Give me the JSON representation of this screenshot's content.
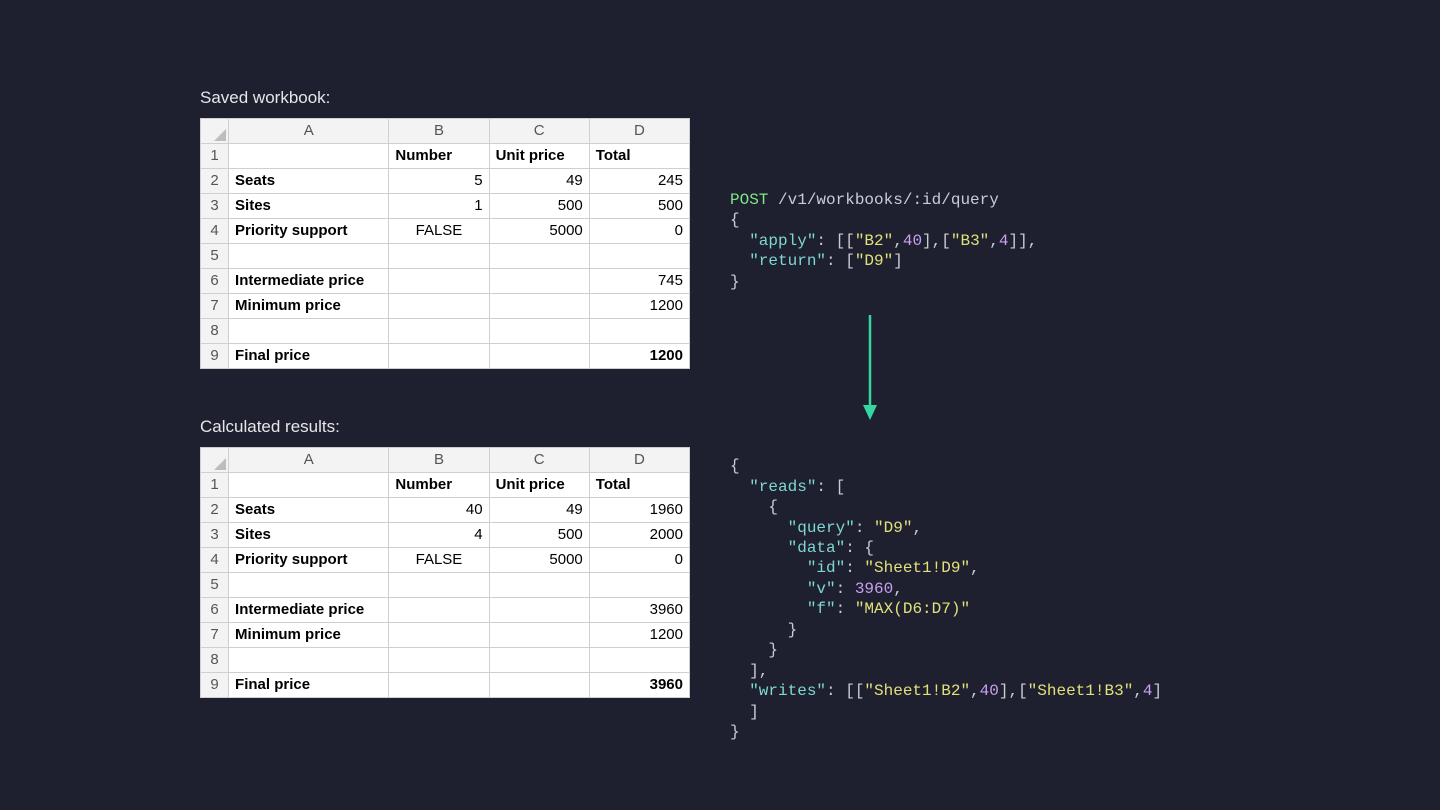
{
  "labels": {
    "saved": "Saved workbook:",
    "calculated": "Calculated results:"
  },
  "columns": [
    "A",
    "B",
    "C",
    "D"
  ],
  "header_row": {
    "B": "Number",
    "C": "Unit price",
    "D": "Total"
  },
  "row_labels": {
    "2": "Seats",
    "3": "Sites",
    "4": "Priority support",
    "6": "Intermediate price",
    "7": "Minimum price",
    "9": "Final price"
  },
  "saved": {
    "B2": "5",
    "C2": "49",
    "D2": "245",
    "B3": "1",
    "C3": "500",
    "D3": "500",
    "B4": "FALSE",
    "C4": "5000",
    "D4": "0",
    "D6": "745",
    "D7": "1200",
    "D9": "1200"
  },
  "calc": {
    "B2": "40",
    "C2": "49",
    "D2": "1960",
    "B3": "4",
    "C3": "500",
    "D3": "2000",
    "B4": "FALSE",
    "C4": "5000",
    "D4": "0",
    "D6": "3960",
    "D7": "1200",
    "D9": "3960"
  },
  "api": {
    "method": "POST",
    "path": "/v1/workbooks/:id/query",
    "request": {
      "apply_key": "\"apply\"",
      "apply_val": "[[\"B2\",40],[\"B3\",4]]",
      "return_key": "\"return\"",
      "return_val": "[\"D9\"]"
    },
    "response": {
      "reads_key": "\"reads\"",
      "query_key": "\"query\"",
      "query_val": "\"D9\"",
      "data_key": "\"data\"",
      "id_key": "\"id\"",
      "id_val": "\"Sheet1!D9\"",
      "v_key": "\"v\"",
      "v_val": "3960",
      "f_key": "\"f\"",
      "f_val": "\"MAX(D6:D7)\"",
      "writes_key": "\"writes\"",
      "writes_val": "[[\"Sheet1!B2\",40],[\"Sheet1!B3\",4]]"
    }
  }
}
